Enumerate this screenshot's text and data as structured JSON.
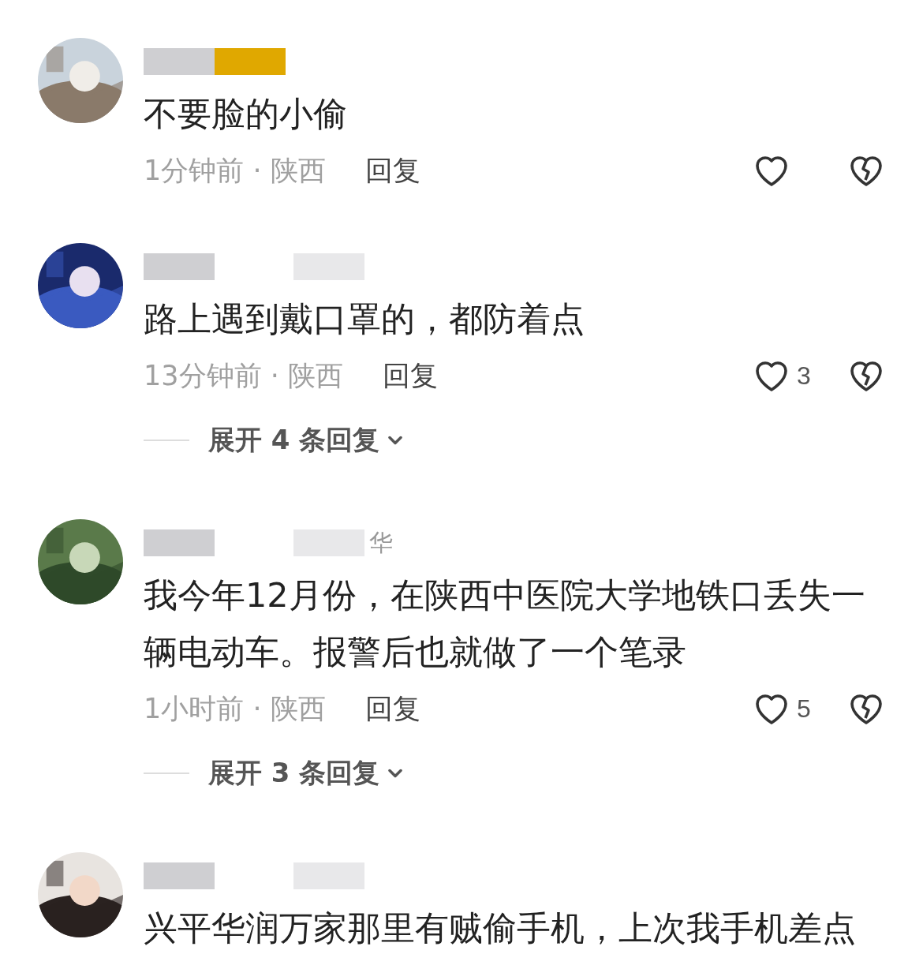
{
  "comments": [
    {
      "redacted": true,
      "text": "不要脸的小偷",
      "time": "1分钟前 · 陕西",
      "reply": "回复"
    },
    {
      "redacted": true,
      "text": "路上遇到戴口罩的，都防着点",
      "time": "13分钟前 · 陕西",
      "reply": "回复",
      "likes": "3",
      "expand_replies": "展开 4 条回复"
    },
    {
      "redacted": true,
      "name_fragment": "华",
      "text": "我今年12月份，在陕西中医院大学地铁口丢失一辆电动车。报警后也就做了一个笔录",
      "time": "1小时前 · 陕西",
      "reply": "回复",
      "likes": "5",
      "expand_replies": "展开 3 条回复"
    },
    {
      "redacted": true,
      "text": "兴平华润万家那里有贼偷手机，上次我手机差点"
    }
  ]
}
